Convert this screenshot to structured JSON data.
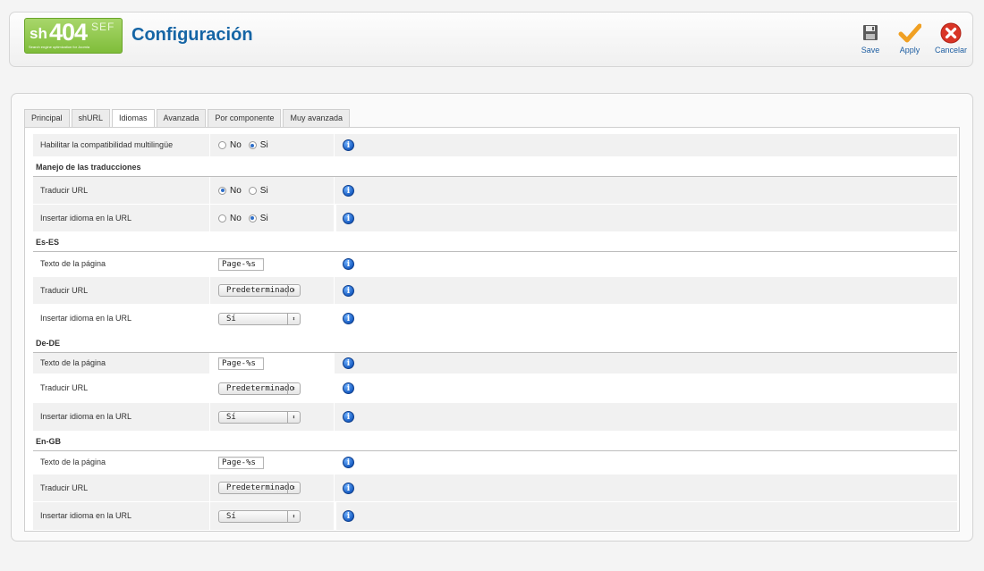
{
  "header": {
    "logo": {
      "prefix": "sh",
      "number": "404",
      "suffix": "SEF",
      "tagline": "Search engine optimization for Joomla"
    },
    "title": "Configuración",
    "toolbar": {
      "save_label": "Save",
      "apply_label": "Apply",
      "cancel_label": "Cancelar"
    }
  },
  "tabs": [
    {
      "label": "Principal",
      "active": false
    },
    {
      "label": "shURL",
      "active": false
    },
    {
      "label": "Idiomas",
      "active": true
    },
    {
      "label": "Avanzada",
      "active": false
    },
    {
      "label": "Por componente",
      "active": false
    },
    {
      "label": "Muy avanzada",
      "active": false
    }
  ],
  "form": {
    "multilingual": {
      "label": "Habilitar la compatibilidad multilingüe",
      "no": "No",
      "yes": "Si",
      "selected": "Si"
    },
    "translations_section": "Manejo de las traducciones",
    "translate_url": {
      "label": "Traducir URL",
      "no": "No",
      "yes": "Si",
      "selected": "No"
    },
    "insert_lang": {
      "label": "Insertar idioma en la URL",
      "no": "No",
      "yes": "Si",
      "selected": "Si"
    },
    "languages": [
      {
        "code": "Es-ES",
        "page_text_label": "Texto de la página",
        "page_text_value": "Page-%s",
        "translate_label": "Traducir URL",
        "translate_value": "Predeterminado",
        "insert_label": "Insertar idioma en la URL",
        "insert_value": "Sí"
      },
      {
        "code": "De-DE",
        "page_text_label": "Texto de la página",
        "page_text_value": "Page-%s",
        "translate_label": "Traducir URL",
        "translate_value": "Predeterminado",
        "insert_label": "Insertar idioma en la URL",
        "insert_value": "Sí"
      },
      {
        "code": "En-GB",
        "page_text_label": "Texto de la página",
        "page_text_value": "Page-%s",
        "translate_label": "Traducir URL",
        "translate_value": "Predeterminado",
        "insert_label": "Insertar idioma en la URL",
        "insert_value": "Sí"
      }
    ]
  },
  "icons": {
    "info": "info-icon",
    "save": "floppy-disk-icon",
    "apply": "checkmark-icon",
    "cancel": "cancel-x-icon",
    "select_arrow": "updown-arrow-icon"
  },
  "colors": {
    "title": "#1565a5",
    "logo_green": "#7fbd3a",
    "apply_orange": "#f0a023",
    "cancel_red": "#d93526",
    "info_blue": "#1a5fc4"
  }
}
